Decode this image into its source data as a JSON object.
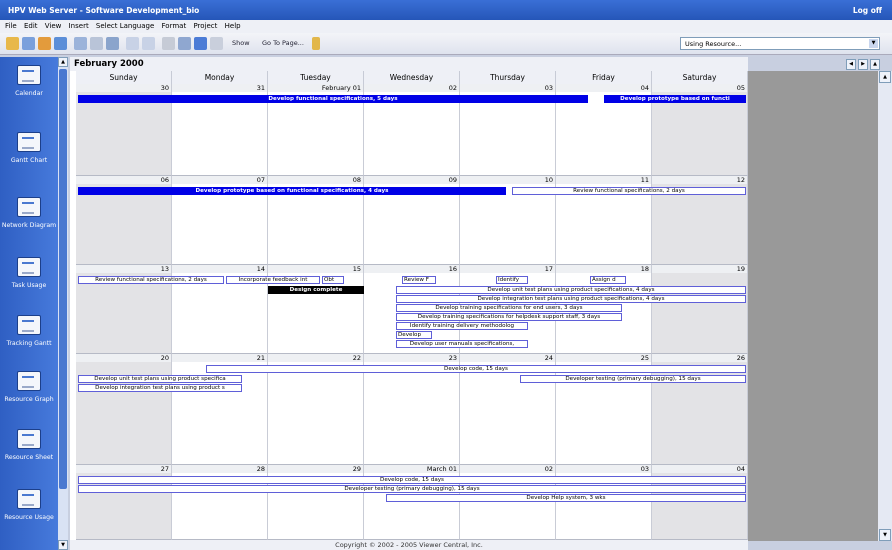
{
  "window_title": "HPV Web Server - Software Development_bio",
  "logoff": "Log off",
  "menu": [
    "File",
    "Edit",
    "View",
    "Insert",
    "Select Language",
    "Format",
    "Project",
    "Help"
  ],
  "toolbar": {
    "show": "Show",
    "goto": "Go To Page...",
    "resource_select": "Using Resource..."
  },
  "sidebar": [
    {
      "label": "Calendar"
    },
    {
      "label": "Gantt Chart"
    },
    {
      "label": "Network Diagram"
    },
    {
      "label": "Task Usage"
    },
    {
      "label": "Tracking Gantt"
    },
    {
      "label": "Resource Graph"
    },
    {
      "label": "Resource Sheet"
    },
    {
      "label": "Resource Usage"
    }
  ],
  "calendar": {
    "month": "February 2000",
    "days": [
      "Sunday",
      "Monday",
      "Tuesday",
      "Wednesday",
      "Thursday",
      "Friday",
      "Saturday"
    ],
    "weeks": [
      {
        "dates": [
          "30",
          "31",
          "February 01",
          "02",
          "03",
          "04",
          "05"
        ],
        "bars": [
          {
            "text": "Develop functional specifications, 5 days",
            "style": "solid"
          },
          {
            "text": "Develop prototype based on functi",
            "style": "solid"
          }
        ]
      },
      {
        "dates": [
          "06",
          "07",
          "08",
          "09",
          "10",
          "11",
          "12"
        ],
        "bars": [
          {
            "text": "Develop prototype based on functional specifications, 4 days",
            "style": "solid"
          },
          {
            "text": "Review functional specifications, 2 days",
            "style": "outline"
          }
        ]
      },
      {
        "dates": [
          "13",
          "14",
          "15",
          "16",
          "17",
          "18",
          "19"
        ],
        "bars": [
          {
            "text": "Review functional specifications, 2 days",
            "style": "outline"
          },
          {
            "text": "Incorporate feedback int",
            "style": "outline"
          },
          {
            "text": "Obt",
            "style": "outline"
          },
          {
            "text": "Review F",
            "style": "outline"
          },
          {
            "text": "Identify",
            "style": "outline"
          },
          {
            "text": "Assign d",
            "style": "outline"
          },
          {
            "text": "Design complete",
            "style": "black"
          },
          {
            "text": "Develop unit test plans using product specifications, 4 days",
            "style": "outline"
          },
          {
            "text": "Develop integration test plans using product specifications, 4 days",
            "style": "outline"
          },
          {
            "text": "Develop training specifications for end users, 3 days",
            "style": "outline"
          },
          {
            "text": "Develop training specifications for helpdesk support staff, 3 days",
            "style": "outline"
          },
          {
            "text": "Identify training delivery methodolog",
            "style": "outline"
          },
          {
            "text": "Develop",
            "style": "outline"
          },
          {
            "text": "Develop user manuals specifications,",
            "style": "outline"
          }
        ]
      },
      {
        "dates": [
          "20",
          "21",
          "22",
          "23",
          "24",
          "25",
          "26"
        ],
        "bars": [
          {
            "text": "Develop code, 15 days",
            "style": "outline"
          },
          {
            "text": "Develop unit test plans using product specifica",
            "style": "outline"
          },
          {
            "text": "Developer testing (primary debugging), 15 days",
            "style": "outline"
          },
          {
            "text": "Develop integration test plans using product s",
            "style": "outline"
          }
        ]
      },
      {
        "dates": [
          "27",
          "28",
          "29",
          "March 01",
          "02",
          "03",
          "04"
        ],
        "bars": [
          {
            "text": "Develop code, 15 days",
            "style": "outline"
          },
          {
            "text": "Developer testing (primary debugging), 15 days",
            "style": "outline"
          },
          {
            "text": "Develop Help system, 3 wks",
            "style": "outline"
          }
        ]
      }
    ]
  },
  "footer": "Copyright © 2002 - 2005 Viewer Central, Inc."
}
